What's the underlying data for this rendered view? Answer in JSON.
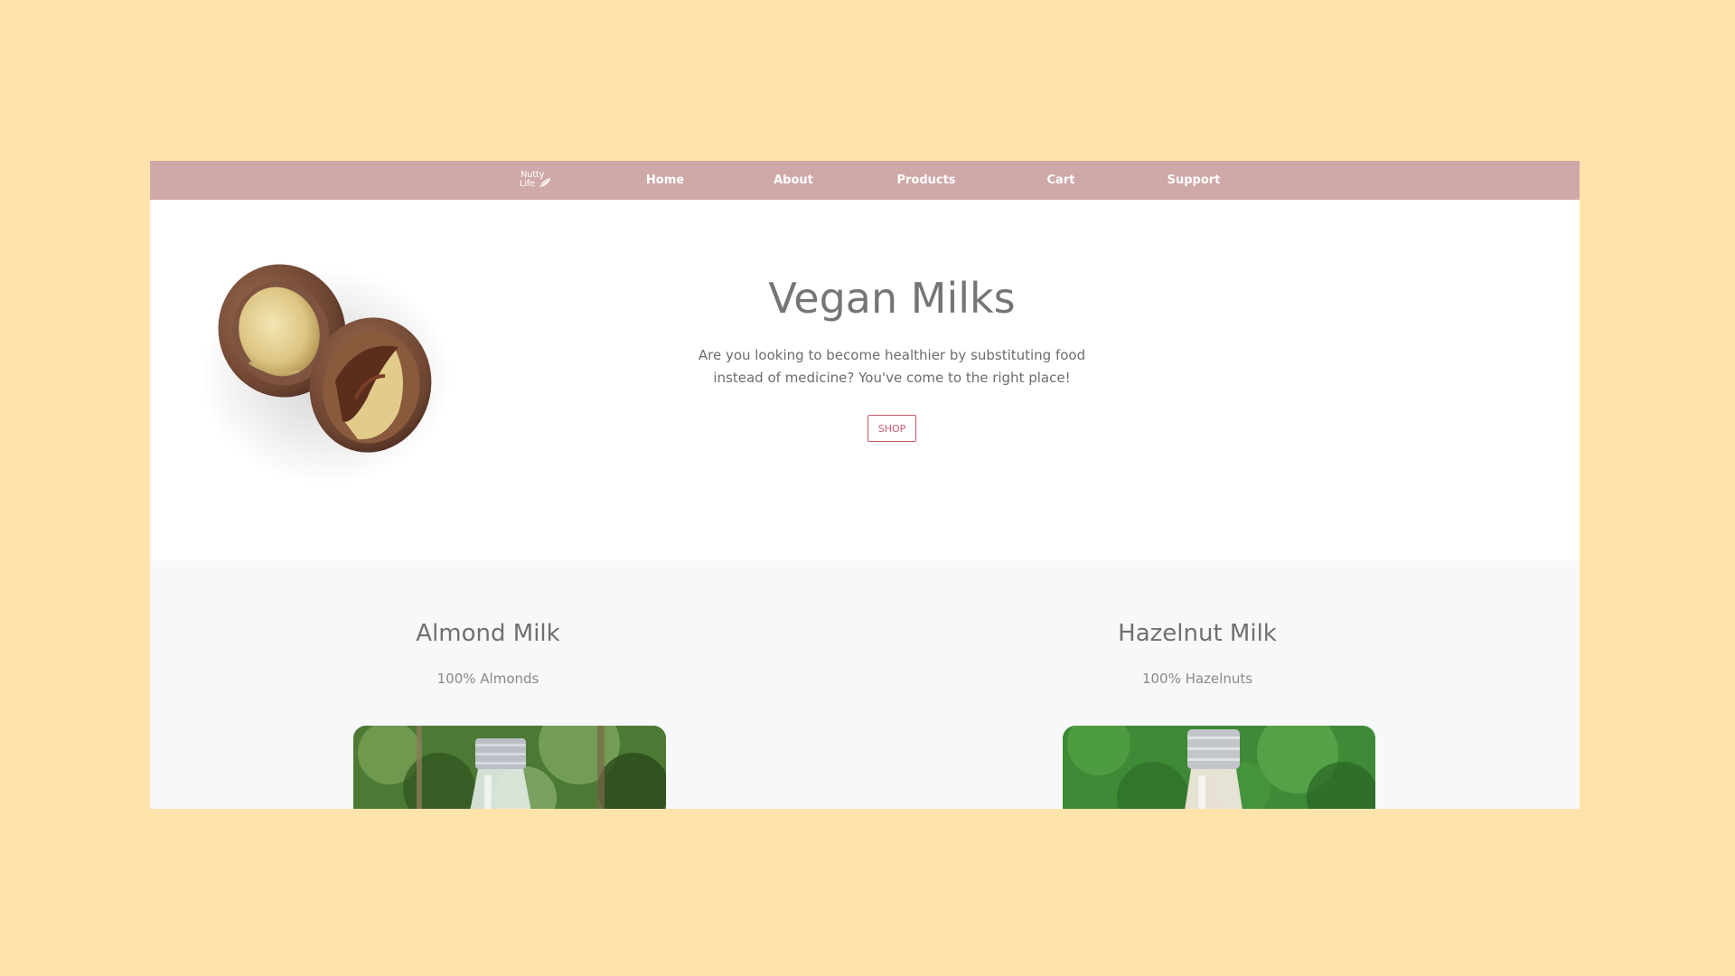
{
  "nav": {
    "logo_line1": "Nutty",
    "logo_line2": "Life",
    "items": [
      {
        "label": "Home"
      },
      {
        "label": "About"
      },
      {
        "label": "Products"
      },
      {
        "label": "Cart"
      },
      {
        "label": "Support"
      }
    ]
  },
  "hero": {
    "title": "Vegan Milks",
    "text": "Are you looking to become healthier by substituting food instead of medicine? You've come to the right place!",
    "button_label": "SHOP",
    "image_icon": "macadamia-nuts-image"
  },
  "products": [
    {
      "name": "Almond Milk",
      "description": "100% Almonds",
      "image_icon": "almond-milk-bottle-image"
    },
    {
      "name": "Hazelnut Milk",
      "description": "100% Hazelnuts",
      "image_icon": "hazelnut-milk-bottle-image"
    }
  ],
  "colors": {
    "page_background": "#fee3ab",
    "navbar": "#cfa8a8",
    "accent": "#c85a6a",
    "products_background": "#f7f8fa"
  }
}
